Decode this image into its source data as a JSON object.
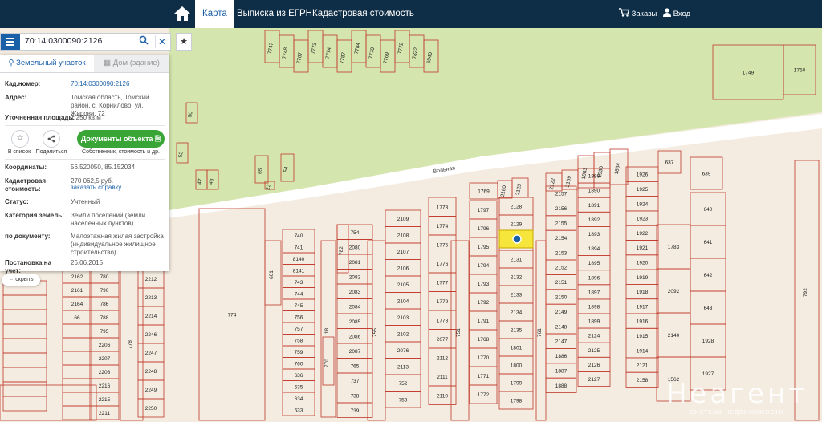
{
  "topbar": {
    "tabs": [
      "Карта",
      "Выписка из ЕГРН",
      "Кадастровая стоимость"
    ],
    "orders": "Заказы",
    "login": "Вход"
  },
  "search": {
    "value": "70:14:0300090:2126"
  },
  "panel": {
    "tab_land": "Земельный участок",
    "tab_house": "Дом (здание)",
    "cad_label": "Кад.номер:",
    "cad_value": "70:14:0300090:2126",
    "addr_label": "Адрес:",
    "addr_value": "Томская область, Томский район, с. Корнилово, ул. Жирова, 72",
    "area_label": "Уточненная площадь:",
    "area_value": "1 250 кв.м",
    "to_list": "В список",
    "share": "Поделиться",
    "docs_button": "Документы объекта",
    "docs_sub": "Собственник, стоимость и др.",
    "coords_label": "Координаты:",
    "coords_value": "56.520050, 85.152034",
    "cost_label": "Кадастровая стоимость:",
    "cost_value": "270 062,5 руб.",
    "cost_link": "заказать справку",
    "status_label": "Статус:",
    "status_value": "Учтенный",
    "category_label": "Категория земель:",
    "category_value": "Земли поселений (земли населенных пунктов)",
    "use_label": "по документу:",
    "use_value": "Малоэтажная жилая застройка (индивидуальное жилищное строительство)",
    "reg_label": "Постановка на учет:",
    "reg_value": "26.06.2015"
  },
  "collapse_label": "скрыть",
  "watermark": {
    "big": "Неагент",
    "small": "СИСТЕМА НЕДВИЖИМОСТИ"
  },
  "map": {
    "street_label": "Вольная",
    "parcels": [
      "7747",
      "7748",
      "7767",
      "7773",
      "7774",
      "7787",
      "7784",
      "7770",
      "7769",
      "7772",
      "7822",
      "6940",
      "1749",
      "1750",
      "3199",
      "3199",
      "3199",
      "50",
      "52",
      "47",
      "48",
      "65",
      "54",
      "23",
      "1769",
      "2180",
      "2123",
      "2122",
      "2159",
      "1883",
      "1930",
      "1884",
      "637",
      "639",
      "640",
      "641",
      "642",
      "643",
      "1928",
      "1927",
      "1926",
      "1925",
      "1924",
      "1923",
      "1922",
      "1921",
      "1920",
      "1919",
      "1918",
      "1917",
      "1916",
      "1915",
      "1914",
      "2121",
      "2158",
      "2157",
      "2156",
      "2155",
      "2154",
      "2153",
      "2152",
      "2151",
      "2150",
      "2149",
      "2148",
      "2147",
      "1886",
      "1887",
      "1888",
      "1889",
      "1890",
      "1891",
      "1892",
      "1893",
      "1894",
      "1895",
      "1896",
      "1897",
      "1898",
      "1899",
      "2124",
      "2125",
      "2126",
      "2127",
      "2128",
      "2129",
      "2130",
      "2131",
      "2132",
      "2133",
      "2134",
      "2135",
      "1801",
      "1800",
      "1799",
      "1798",
      "1797",
      "1796",
      "1795",
      "1794",
      "1793",
      "1792",
      "1791",
      "1768",
      "1770",
      "1771",
      "1772",
      "1773",
      "1774",
      "1775",
      "1776",
      "1777",
      "1779",
      "1778",
      "2077",
      "2112",
      "2111",
      "2110",
      "2109",
      "2108",
      "2107",
      "2106",
      "2105",
      "2104",
      "2103",
      "2102",
      "2076",
      "2113",
      "752",
      "753",
      "754",
      "2080",
      "2081",
      "2082",
      "2083",
      "2084",
      "2085",
      "2086",
      "2087",
      "765",
      "737",
      "738",
      "739",
      "740",
      "741",
      "8140",
      "8141",
      "743",
      "744",
      "745",
      "756",
      "757",
      "758",
      "759",
      "760",
      "636",
      "635",
      "634",
      "633",
      "1783",
      "2092",
      "2140",
      "1562",
      "751",
      "755",
      "761",
      "601",
      "18",
      "770",
      "782",
      "792",
      "774",
      "778",
      "780",
      "790",
      "786",
      "788",
      "795",
      "2206",
      "2207",
      "2208",
      "2216",
      "2215",
      "2211",
      "2212",
      "2213",
      "2214",
      "2246",
      "2247",
      "2248",
      "2249",
      "2250",
      "2162",
      "2161",
      "2164",
      "66"
    ]
  }
}
